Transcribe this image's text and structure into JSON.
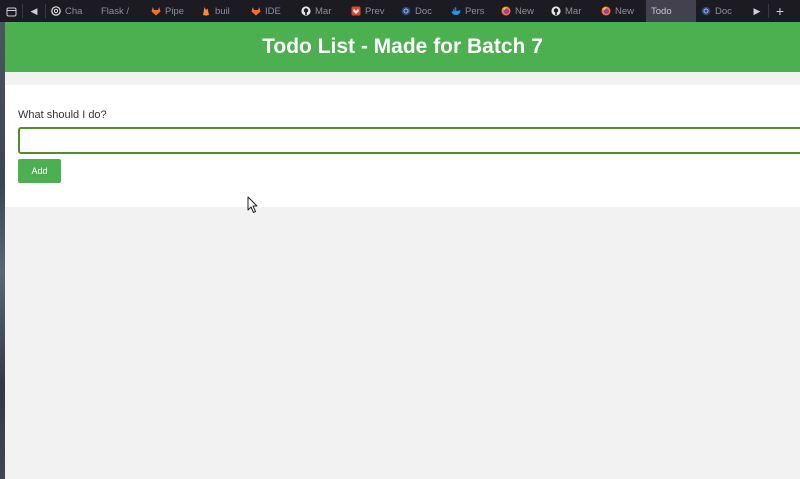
{
  "browser": {
    "tabs": [
      {
        "label": "Cha",
        "icon": "openai-icon",
        "active": false
      },
      {
        "label": "Flask /",
        "icon": "none",
        "active": false
      },
      {
        "label": "Pipe",
        "icon": "gitlab-icon",
        "active": false
      },
      {
        "label": "buil",
        "icon": "firebase-icon",
        "active": false
      },
      {
        "label": "IDE",
        "icon": "gitlab-icon",
        "active": false
      },
      {
        "label": "Mar",
        "icon": "github-icon",
        "active": false
      },
      {
        "label": "Prev",
        "icon": "gitlab-orange-icon",
        "active": false
      },
      {
        "label": "Doc",
        "icon": "docs-icon",
        "active": false
      },
      {
        "label": "Pers",
        "icon": "docker-icon",
        "active": false
      },
      {
        "label": "New",
        "icon": "firefox-icon",
        "active": false
      },
      {
        "label": "Mar",
        "icon": "github-icon",
        "active": false
      },
      {
        "label": "New",
        "icon": "firefox-icon",
        "active": false
      },
      {
        "label": "Todo",
        "icon": "none",
        "active": true
      },
      {
        "label": "Doc",
        "icon": "docs-icon",
        "active": false
      }
    ],
    "new_tab_glyph": "+"
  },
  "app": {
    "title": "Todo List - Made for Batch 7",
    "input_label": "What should I do?",
    "input_value": "",
    "add_label": "Add",
    "accent": "#4caf50"
  }
}
